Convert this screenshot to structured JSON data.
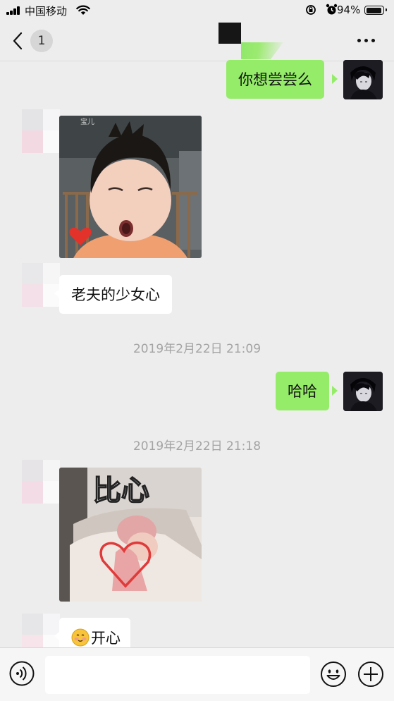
{
  "status_bar": {
    "carrier": "中国移动",
    "battery": "94%"
  },
  "nav": {
    "unread_count": "1"
  },
  "messages": [
    {
      "side": "out",
      "type": "text",
      "text": "你想尝尝么"
    },
    {
      "side": "in",
      "type": "image",
      "image_watermark": "宝儿"
    },
    {
      "side": "in",
      "type": "text",
      "text": "老夫的少女心"
    },
    {
      "type": "timestamp",
      "text": "2019年2月22日 21:09"
    },
    {
      "side": "out",
      "type": "text",
      "text": "哈哈"
    },
    {
      "type": "timestamp",
      "text": "2019年2月22日 21:18"
    },
    {
      "side": "in",
      "type": "image",
      "image_caption": "比心"
    },
    {
      "side": "in",
      "type": "text",
      "text": "开心",
      "emoji": "smiling-face-emoji"
    }
  ],
  "input_bar": {
    "text": ""
  },
  "colors": {
    "outgoing_bubble": "#95ec69",
    "incoming_bubble": "#ffffff",
    "background": "#ededed"
  }
}
